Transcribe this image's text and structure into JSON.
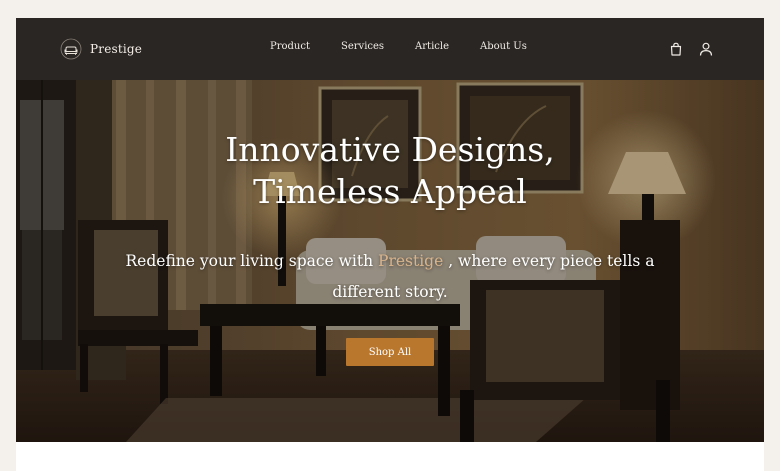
{
  "brand": {
    "name": "Prestige",
    "logo_icon": "sofa-logo-icon"
  },
  "nav": {
    "links": [
      "Product",
      "Services",
      "Article",
      "About Us"
    ],
    "icons": [
      "shopping-bag-icon",
      "user-icon"
    ]
  },
  "hero": {
    "title_line1": "Innovative Designs,",
    "title_line2": "Timeless Appeal",
    "subtitle_pre": "Redefine your living space with",
    "subtitle_brand": "Prestige",
    "subtitle_post": ", where every piece tells a different story.",
    "cta_label": "Shop All"
  },
  "colors": {
    "navbar_bg": "#2a2624",
    "accent": "#b9772e",
    "brand_text_highlight": "#d8b48c",
    "page_bg": "#f4f1ed"
  }
}
